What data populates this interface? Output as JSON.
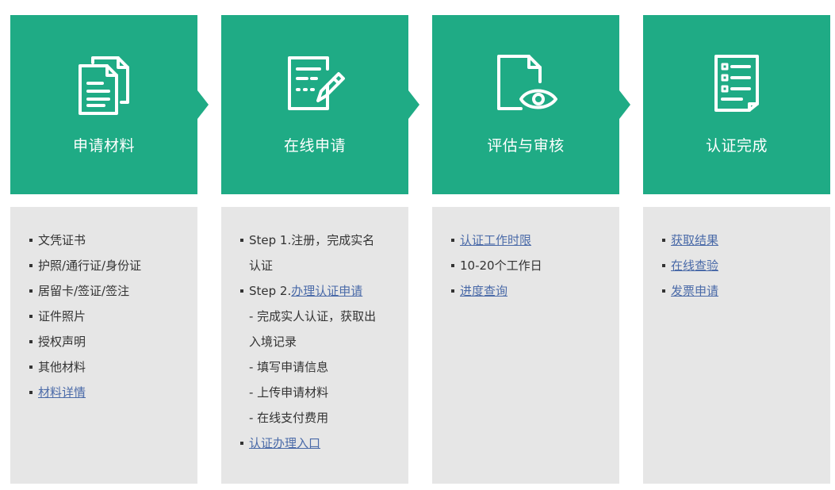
{
  "columns": [
    {
      "title": "申请材料",
      "icon": "documents-icon",
      "items": [
        {
          "text": "文凭证书"
        },
        {
          "text": "护照/通行证/身份证"
        },
        {
          "text": "居留卡/签证/签注"
        },
        {
          "text": "证件照片"
        },
        {
          "text": "授权声明"
        },
        {
          "text": "其他材料"
        },
        {
          "link": "材料详情"
        }
      ]
    },
    {
      "title": "在线申请",
      "icon": "edit-form-icon",
      "items": [
        {
          "text": "Step 1.注册，完成实名"
        },
        {
          "text": "认证"
        },
        {
          "text": "Step 2.",
          "link": "办理认证申请"
        },
        {
          "text": "- 完成实人认证，获取出"
        },
        {
          "text": "入境记录"
        },
        {
          "text": "- 填写申请信息"
        },
        {
          "text": "- 上传申请材料"
        },
        {
          "text": "- 在线支付费用"
        },
        {
          "link": "认证办理入口"
        }
      ]
    },
    {
      "title": "评估与审核",
      "icon": "document-eye-icon",
      "items": [
        {
          "link": "认证工作时限"
        },
        {
          "text": "10-20个工作日"
        },
        {
          "link": "进度查询"
        }
      ]
    },
    {
      "title": "认证完成",
      "icon": "checklist-icon",
      "items": [
        {
          "link": "获取结果"
        },
        {
          "link": "在线查验"
        },
        {
          "link": "发票申请"
        }
      ]
    }
  ],
  "colors": {
    "header_green": "#1fab85",
    "panel_gray": "#e6e6e6",
    "link_blue": "#4a6aa8"
  }
}
